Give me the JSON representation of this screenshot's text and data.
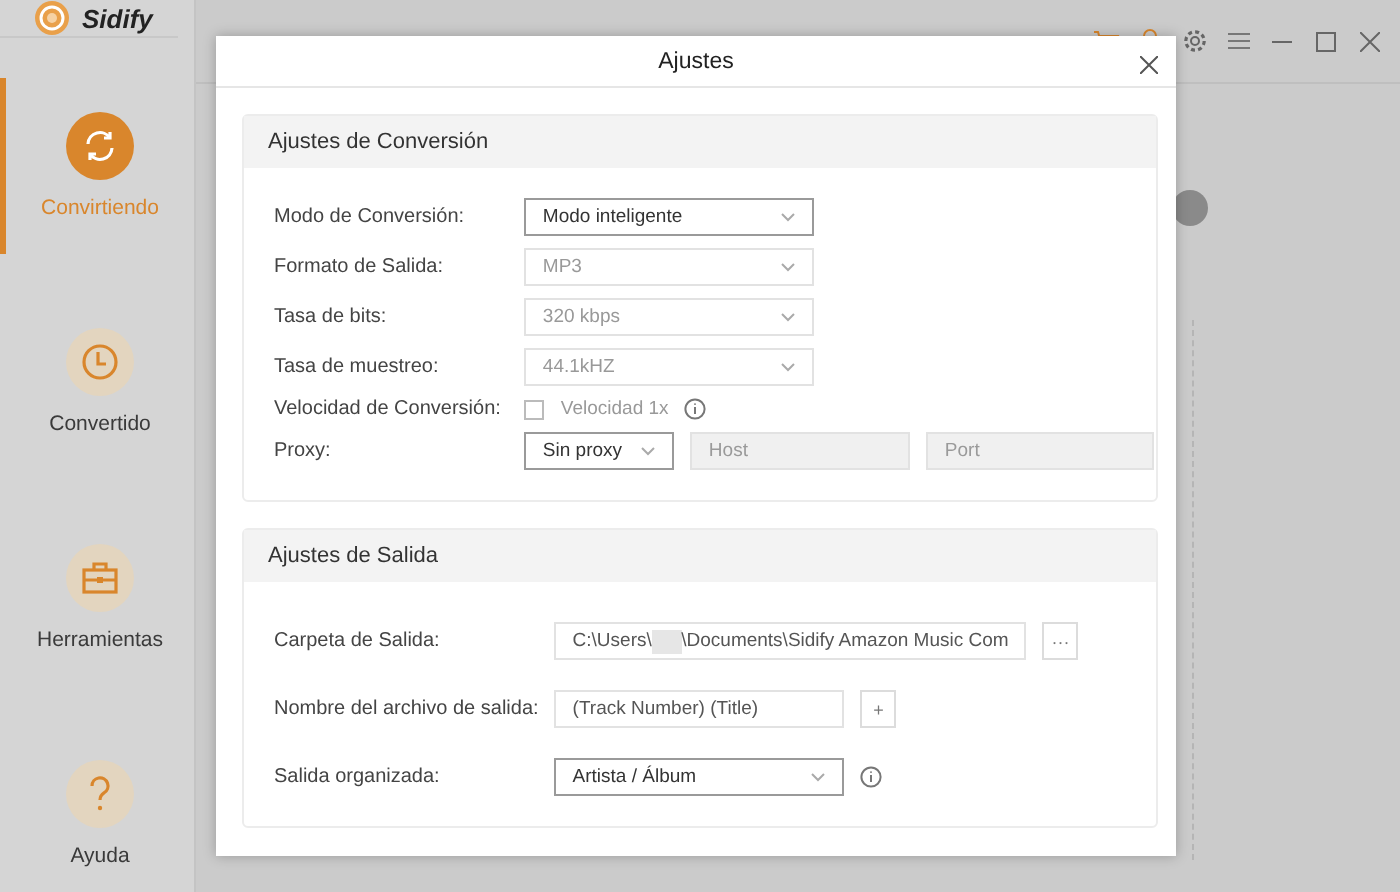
{
  "app": {
    "name": "Sidify"
  },
  "sidebar": {
    "items": [
      {
        "label": "Convirtiendo",
        "kind": "convert",
        "selected": true
      },
      {
        "label": "Convertido",
        "kind": "clock",
        "selected": false
      },
      {
        "label": "Herramientas",
        "kind": "toolbox",
        "selected": false
      },
      {
        "label": "Ayuda",
        "kind": "help",
        "selected": false
      }
    ]
  },
  "dialog": {
    "title": "Ajustes",
    "sections": [
      {
        "title": "Ajustes de Conversión",
        "rows": [
          {
            "kind": "select",
            "label": "Modo de Conversión:",
            "value": "Modo inteligente",
            "disabled": false,
            "info": false
          },
          {
            "kind": "select",
            "label": "Formato de Salida:",
            "value": "MP3",
            "disabled": true,
            "info": false
          },
          {
            "kind": "select",
            "label": "Tasa de bits:",
            "value": "320 kbps",
            "disabled": true,
            "info": false
          },
          {
            "kind": "select",
            "label": "Tasa de muestreo:",
            "value": "44.1kHZ",
            "disabled": true,
            "info": false
          },
          {
            "kind": "checkbox",
            "label": "Velocidad de Conversión:",
            "option": "Velocidad 1x",
            "checked": false,
            "info": true
          },
          {
            "kind": "proxy",
            "label": "Proxy:",
            "value": "Sin proxy",
            "host_placeholder": "Host",
            "port_placeholder": "Port"
          }
        ]
      },
      {
        "title": "Ajustes de Salida",
        "rows": [
          {
            "kind": "folder",
            "label": "Carpeta de Salida:",
            "path_start": "C:\\Users\\",
            "path_end": "\\Documents\\Sidify Amazon Music Com",
            "button": "···"
          },
          {
            "kind": "filename",
            "label": "Nombre del archivo de salida:",
            "value": "(Track Number) (Title)",
            "button": "+"
          },
          {
            "kind": "select",
            "label": "Salida organizada:",
            "value": "Artista / Álbum",
            "disabled": false,
            "info": true
          }
        ]
      }
    ]
  }
}
